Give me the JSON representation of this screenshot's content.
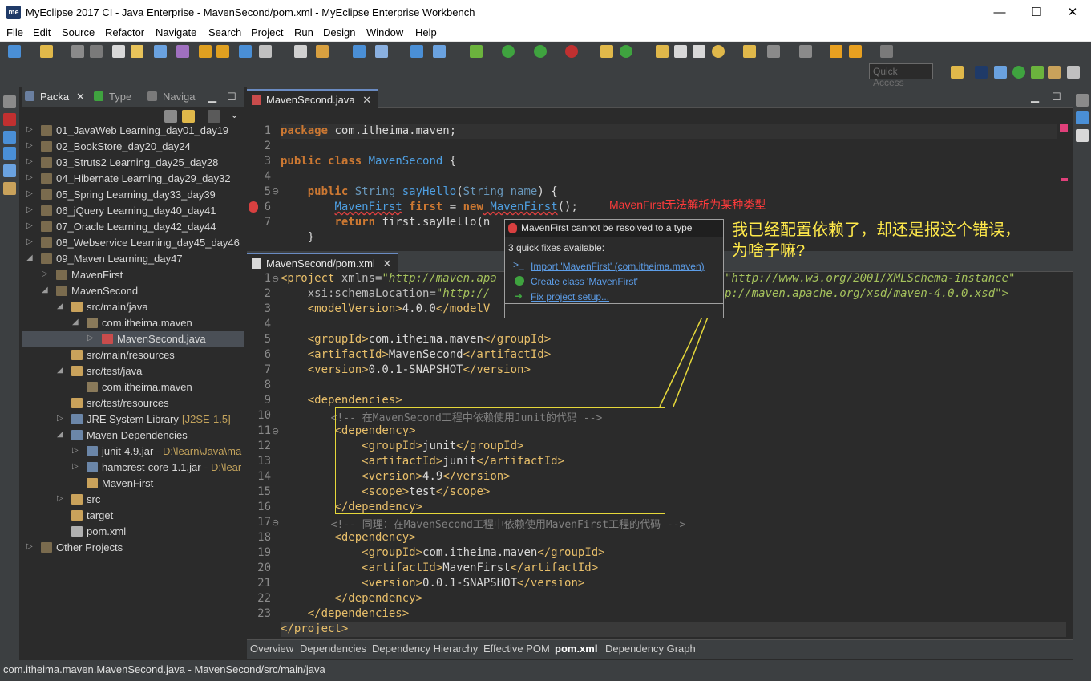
{
  "window": {
    "app_icon": "me",
    "title": "MyEclipse 2017 CI - Java Enterprise - MavenSecond/pom.xml - MyEclipse Enterprise Workbench",
    "minimize": "—",
    "maximize": "☐",
    "close": "✕"
  },
  "menu": [
    "File",
    "Edit",
    "Source",
    "Refactor",
    "Navigate",
    "Search",
    "Project",
    "Run",
    "Design",
    "Window",
    "Help"
  ],
  "toolbar": {
    "quick_access_placeholder": "Quick Access",
    "accent": "#3c3f41"
  },
  "explorer": {
    "tabs": [
      "Packa",
      "Type",
      "Naviga"
    ],
    "tab_close": "✕",
    "rows": [
      {
        "label": "01_JavaWeb Learning_day01_day19",
        "deco": ""
      },
      {
        "label": "02_BookStore_day20_day24",
        "deco": ""
      },
      {
        "label": "03_Struts2 Learning_day25_day28",
        "deco": ""
      },
      {
        "label": "04_Hibernate Learning_day29_day32",
        "deco": ""
      },
      {
        "label": "05_Spring Learning_day33_day39",
        "deco": ""
      },
      {
        "label": "06_jQuery Learning_day40_day41",
        "deco": ""
      },
      {
        "label": "07_Oracle Learning_day42_day44",
        "deco": ""
      },
      {
        "label": "08_Webservice Learning_day45_day46",
        "deco": ""
      },
      {
        "label": "09_Maven Learning_day47",
        "deco": ""
      },
      {
        "label": "MavenFirst",
        "deco": ""
      },
      {
        "label": "MavenSecond",
        "deco": ""
      },
      {
        "label": "src/main/java",
        "deco": ""
      },
      {
        "label": "com.itheima.maven",
        "deco": ""
      },
      {
        "label": "MavenSecond.java",
        "deco": ""
      },
      {
        "label": "src/main/resources",
        "deco": ""
      },
      {
        "label": "src/test/java",
        "deco": ""
      },
      {
        "label": "com.itheima.maven",
        "deco": ""
      },
      {
        "label": "src/test/resources",
        "deco": ""
      },
      {
        "label": "JRE System Library",
        "deco": "[J2SE-1.5]"
      },
      {
        "label": "Maven Dependencies",
        "deco": ""
      },
      {
        "label": "junit-4.9.jar",
        "deco": "- D:\\learn\\Java\\ma"
      },
      {
        "label": "hamcrest-core-1.1.jar",
        "deco": "- D:\\lear"
      },
      {
        "label": "MavenFirst",
        "deco": ""
      },
      {
        "label": "src",
        "deco": ""
      },
      {
        "label": "target",
        "deco": ""
      },
      {
        "label": "pom.xml",
        "deco": ""
      },
      {
        "label": "Other Projects",
        "deco": ""
      }
    ]
  },
  "editor1": {
    "tab": "MavenSecond.java",
    "lines": [
      "1",
      "2",
      "3",
      "4",
      "5",
      "6",
      "7"
    ],
    "code": {
      "l1_kw": "package",
      "l1_rest": " com.itheima.maven;",
      "l3_kw1": "public",
      "l3_kw2": "class",
      "l3_name": "MavenSecond",
      "l3_rest": " {",
      "l5_kw": "public",
      "l5_type": "String",
      "l5_name": "sayHello",
      "l5_p1": "(",
      "l5_ptype": "String",
      "l5_pname": " name",
      "l5_rest": ") {",
      "l6_type": "MavenFirst",
      "l6_var": " first",
      "l6_eq": " = ",
      "l6_new": "new",
      "l6_cls": " MavenFirst",
      "l6_rest": "();",
      "l7_kw": "return",
      "l7_rest": " first.sayHello(n",
      "l8": "}"
    }
  },
  "popup": {
    "title": "MavenFirst cannot be resolved to a type",
    "count": "3 quick fixes available:",
    "fixes": [
      "Import 'MavenFirst' (com.itheima.maven)",
      "Create class 'MavenFirst'",
      "Fix project setup..."
    ]
  },
  "annotations": {
    "error_cn": "MavenFirst无法解析为某种类型",
    "bubble_line1": "我已经配置依赖了，却还是报这个错误，",
    "bubble_line2": "为啥子嘛?"
  },
  "editor2": {
    "tab": "MavenSecond/pom.xml",
    "lines": [
      "1",
      "2",
      "3",
      "4",
      "5",
      "6",
      "7",
      "8",
      "9",
      "10",
      "11",
      "12",
      "13",
      "14",
      "15",
      "16",
      "17",
      "18",
      "19",
      "20",
      "21",
      "22",
      "23"
    ],
    "code": {
      "l1_a": "<project",
      "l1_b": " xmlns=",
      "l1_c": "\"http://maven.apa",
      "l1_d": "\"http://www.w3.org/2001/XMLSchema-instance\"",
      "l2_a": "    xsi:schemaLocation=",
      "l2_b": "\"http://",
      "l2_c": "p://maven.apache.org/xsd/maven-4.0.0.xsd\">",
      "l3_a": "    <modelVersion>",
      "l3_b": "4.0.0",
      "l3_c": "</modelV",
      "l5_a": "    <groupId>",
      "l5_b": "com.itheima.maven",
      "l5_c": "</groupId>",
      "l6_a": "    <artifactId>",
      "l6_b": "MavenSecond",
      "l6_c": "</artifactId>",
      "l7_a": "    <version>",
      "l7_b": "0.0.1-SNAPSHOT",
      "l7_c": "</version>",
      "l9": "    <dependencies>",
      "l10": "        <!-- 在MavenSecond工程中依赖使用Junit的代码 -->",
      "l11": "        <dependency>",
      "l12_a": "            <groupId>",
      "l12_b": "junit",
      "l12_c": "</groupId>",
      "l13_a": "            <artifactId>",
      "l13_b": "junit",
      "l13_c": "</artifactId>",
      "l14_a": "            <version>",
      "l14_b": "4.9",
      "l14_c": "</version>",
      "l15_a": "            <scope>",
      "l15_b": "test",
      "l15_c": "</scope>",
      "l16": "        </dependency>",
      "l17": "        <!-- 同理：在MavenSecond工程中依赖使用MavenFirst工程的代码 -->",
      "l18": "        <dependency>",
      "l19_a": "            <groupId>",
      "l19_b": "com.itheima.maven",
      "l19_c": "</groupId>",
      "l20_a": "            <artifactId>",
      "l20_b": "MavenFirst",
      "l20_c": "</artifactId>",
      "l21_a": "            <version>",
      "l21_b": "0.0.1-SNAPSHOT",
      "l21_c": "</version>",
      "l22": "        </dependency>",
      "l23": "    </dependencies>",
      "l24": "</project>"
    }
  },
  "bottom_tabs": [
    "Overview",
    "Dependencies",
    "Dependency Hierarchy",
    "Effective POM",
    "pom.xml",
    "Dependency Graph"
  ],
  "status": "com.itheima.maven.MavenSecond.java - MavenSecond/src/main/java"
}
